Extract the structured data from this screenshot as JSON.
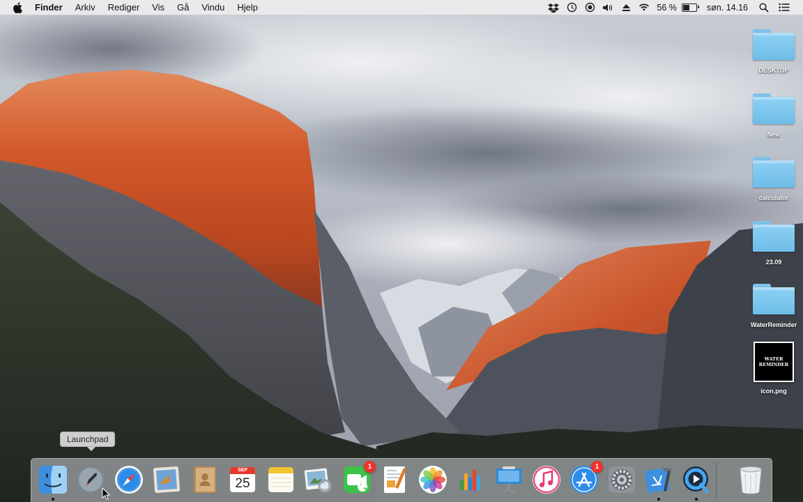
{
  "menubar": {
    "app_name": "Finder",
    "menus": [
      "Arkiv",
      "Rediger",
      "Vis",
      "Gå",
      "Vindu",
      "Hjelp"
    ],
    "status": {
      "icons": [
        "dropbox-icon",
        "time-machine-icon",
        "record-icon",
        "volume-icon",
        "eject-icon",
        "wifi-icon"
      ],
      "battery_percent": "56 %",
      "battery_level": 0.56,
      "clock": "søn. 14.16",
      "extra_icons": [
        "spotlight-icon",
        "notification-center-icon"
      ]
    }
  },
  "desktop": {
    "items": [
      {
        "label": "DESKTOP",
        "kind": "folder"
      },
      {
        "label": "New",
        "kind": "folder"
      },
      {
        "label": "calculator",
        "kind": "folder"
      },
      {
        "label": "23.09",
        "kind": "folder"
      },
      {
        "label": "WaterReminder",
        "kind": "folder"
      },
      {
        "label": "icon.png",
        "kind": "image",
        "thumb_text": "WATER REMINDER"
      }
    ]
  },
  "tooltip": {
    "text": "Launchpad"
  },
  "dock": {
    "apps": [
      {
        "name": "Finder",
        "icon": "finder-icon",
        "running": true
      },
      {
        "name": "Launchpad",
        "icon": "launchpad-icon",
        "running": false
      },
      {
        "name": "Safari",
        "icon": "safari-icon",
        "running": false
      },
      {
        "name": "Mail",
        "icon": "mail-icon",
        "running": false
      },
      {
        "name": "Contacts",
        "icon": "contacts-icon",
        "running": false
      },
      {
        "name": "Calendar",
        "icon": "calendar-icon",
        "running": false,
        "month": "SEP",
        "day": "25"
      },
      {
        "name": "Notes",
        "icon": "notes-icon",
        "running": false
      },
      {
        "name": "Preview",
        "icon": "preview-icon",
        "running": false
      },
      {
        "name": "FaceTime",
        "icon": "facetime-icon",
        "running": false,
        "badge": "1"
      },
      {
        "name": "Pages",
        "icon": "pages-icon",
        "running": false
      },
      {
        "name": "Photos",
        "icon": "photos-icon",
        "running": false
      },
      {
        "name": "Numbers",
        "icon": "numbers-icon",
        "running": false
      },
      {
        "name": "Keynote",
        "icon": "keynote-icon",
        "running": false
      },
      {
        "name": "iTunes",
        "icon": "itunes-icon",
        "running": false
      },
      {
        "name": "App Store",
        "icon": "app-store-icon",
        "running": false,
        "badge": "1"
      },
      {
        "name": "System Preferences",
        "icon": "system-preferences-icon",
        "running": false
      },
      {
        "name": "Xcode",
        "icon": "xcode-icon",
        "running": true
      },
      {
        "name": "QuickTime Player",
        "icon": "quicktime-icon",
        "running": true
      },
      {
        "name": "Trash",
        "icon": "trash-icon",
        "running": false
      }
    ]
  },
  "colors": {
    "menubar_bg": "#ececee",
    "folder_blue": "#7cc2ea",
    "badge_red": "#f0302c",
    "rock_orange": "#d9652e"
  }
}
